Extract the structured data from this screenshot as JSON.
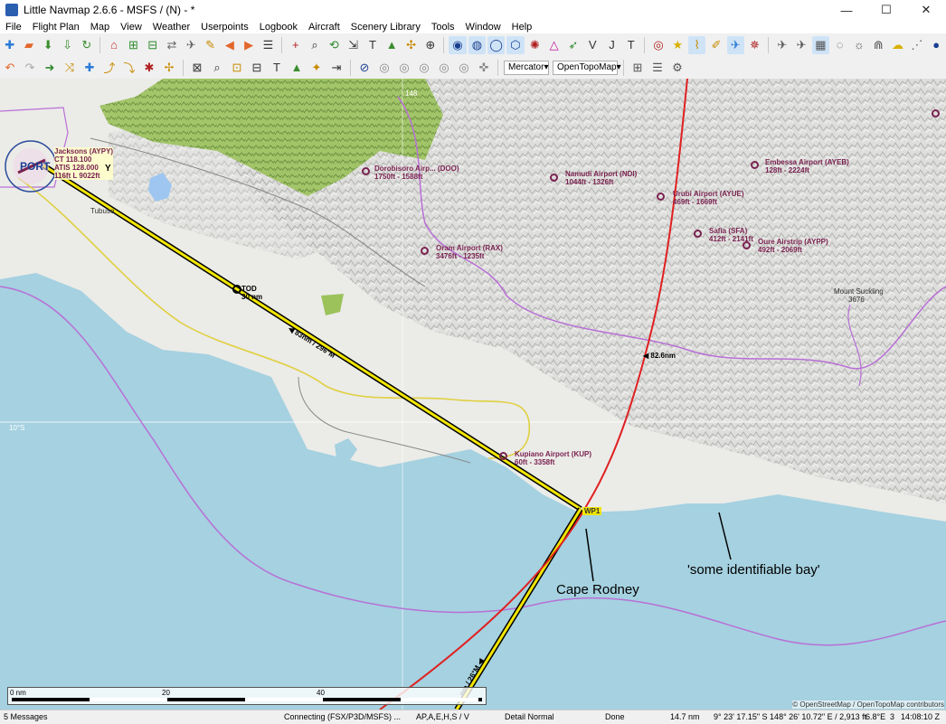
{
  "window": {
    "title": "Little Navmap 2.6.6 - MSFS / (N) - *",
    "minimize": "—",
    "maximize": "☐",
    "close": "✕"
  },
  "menu": [
    "File",
    "Flight Plan",
    "Map",
    "View",
    "Weather",
    "Userpoints",
    "Logbook",
    "Aircraft",
    "Scenery Library",
    "Tools",
    "Window",
    "Help"
  ],
  "toolbar2": {
    "projection": "Mercator",
    "theme": "OpenTopoMap"
  },
  "map": {
    "airports": [
      {
        "name": "Dorobisoro Airp... (DOO)",
        "info": "1750ft - 1588ft"
      },
      {
        "name": "Namudi Airport (NDI)",
        "info": "1044ft - 1326ft"
      },
      {
        "name": "Embessa Airport (AYEB)",
        "info": "128ft - 2224ft"
      },
      {
        "name": "Urubi Airport (AYUE)",
        "info": "469ft - 1669ft"
      },
      {
        "name": "Safia (SFA)",
        "info": "412ft - 2141ft"
      },
      {
        "name": "Oure Airstrip (AYPP)",
        "info": "492ft - 2069ft"
      },
      {
        "name": "Oram Airport (RAX)",
        "info": "3476ft - 1235ft"
      },
      {
        "name": "Kupiano Airport (KUP)",
        "info": "60ft - 3358ft"
      }
    ],
    "departure": {
      "name": "Jacksons (AYPY)",
      "ct": "CT 118.100",
      "atis": "ATIS 128.000",
      "rwy": "116ft L 9022ft",
      "city": "PORT",
      "city_suffix": "Y"
    },
    "tod": {
      "label": "TOD",
      "dist": "30 nm"
    },
    "leg1": "◀ 83nm / 296°M",
    "leg2": "◀ 82.6nm",
    "leg3": "nm / 26°M ◀",
    "wp": "WP1",
    "latitude": "10°S",
    "mount": "Mount Suckling",
    "mount_elev": "3676",
    "town": "Tubuse",
    "elev148": "148",
    "annotations": [
      "Cape Rodney",
      "'some identifiable bay'"
    ],
    "scale": [
      "0 nm",
      "20",
      "40"
    ],
    "copyright": "© OpenStreetMap / OpenTopoMap contributors"
  },
  "status": {
    "messages": "5 Messages",
    "connection": "Connecting (FSX/P3D/MSFS) ...",
    "flags": "AP,A,E,H,S / V",
    "detail": "Detail Normal",
    "state": "Done",
    "distance": "14.7 nm",
    "coords": "9° 23' 17.15\" S 148° 26' 10.72\" E / 2,913 ft",
    "magvar": "6.8°E",
    "num": "3",
    "time": "14:08:10 Z"
  }
}
